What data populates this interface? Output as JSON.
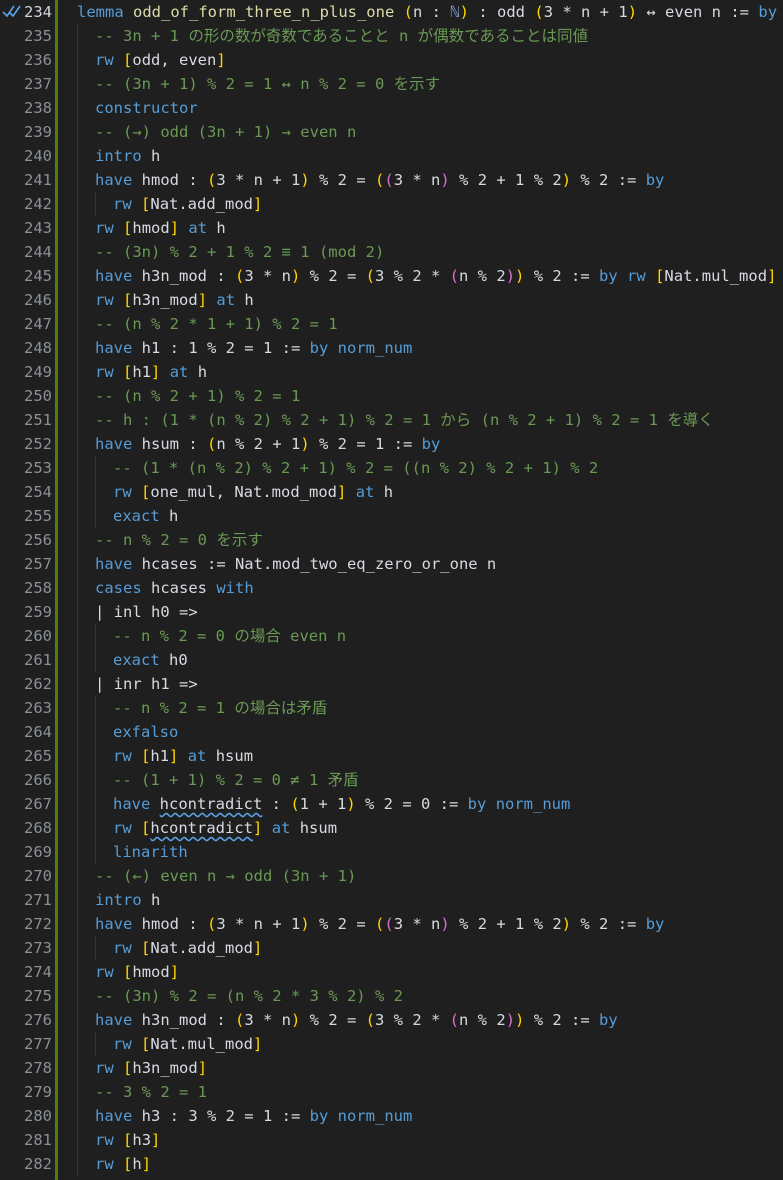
{
  "colors": {
    "keyword": "#569cd6",
    "comment": "#6a9955",
    "type": "#8aa8e0",
    "func": "#dcdcaa",
    "b1": "#ffd700",
    "b2": "#da70d6",
    "b3": "#179fff",
    "text": "#d7dae0",
    "gutter": "#8a8f98",
    "gutter_current": "#cfd3da"
  },
  "icons": {
    "line_234": "double-check-icon"
  },
  "lines": [
    {
      "n": "234",
      "indent": 0,
      "current": true,
      "tokens": [
        [
          "k",
          "lemma"
        ],
        [
          "p",
          " "
        ],
        [
          "f",
          "odd_of_form_three_n_plus_one"
        ],
        [
          "p",
          " "
        ],
        [
          "b1",
          "("
        ],
        [
          "p",
          "n : "
        ],
        [
          "t",
          "ℕ"
        ],
        [
          "b1",
          ")"
        ],
        [
          "p",
          " : odd "
        ],
        [
          "b1",
          "("
        ],
        [
          "p",
          "3 * n + 1"
        ],
        [
          "b1",
          ")"
        ],
        [
          "p",
          " ↔ even n := "
        ],
        [
          "k",
          "by"
        ]
      ]
    },
    {
      "n": "235",
      "indent": 1,
      "tokens": [
        [
          "c",
          "-- 3n + 1 の形の数が奇数であることと n が偶数であることは同値"
        ]
      ]
    },
    {
      "n": "236",
      "indent": 1,
      "tokens": [
        [
          "k",
          "rw"
        ],
        [
          "p",
          " "
        ],
        [
          "b1",
          "["
        ],
        [
          "p",
          "odd, even"
        ],
        [
          "b1",
          "]"
        ]
      ]
    },
    {
      "n": "237",
      "indent": 1,
      "tokens": [
        [
          "c",
          "-- (3n + 1) % 2 = 1 ↔ n % 2 = 0 を示す"
        ]
      ]
    },
    {
      "n": "238",
      "indent": 1,
      "tokens": [
        [
          "k",
          "constructor"
        ]
      ]
    },
    {
      "n": "239",
      "indent": 1,
      "tokens": [
        [
          "c",
          "-- (→) odd (3n + 1) → even n"
        ]
      ]
    },
    {
      "n": "240",
      "indent": 1,
      "tokens": [
        [
          "k",
          "intro"
        ],
        [
          "p",
          " h"
        ]
      ]
    },
    {
      "n": "241",
      "indent": 1,
      "tokens": [
        [
          "k",
          "have"
        ],
        [
          "p",
          " hmod : "
        ],
        [
          "b1",
          "("
        ],
        [
          "p",
          "3 * n + 1"
        ],
        [
          "b1",
          ")"
        ],
        [
          "p",
          " % 2 = "
        ],
        [
          "b1",
          "("
        ],
        [
          "b2",
          "("
        ],
        [
          "p",
          "3 * n"
        ],
        [
          "b2",
          ")"
        ],
        [
          "p",
          " % 2 + 1 % 2"
        ],
        [
          "b1",
          ")"
        ],
        [
          "p",
          " % 2 := "
        ],
        [
          "k",
          "by"
        ]
      ]
    },
    {
      "n": "242",
      "indent": 2,
      "tokens": [
        [
          "k",
          "rw"
        ],
        [
          "p",
          " "
        ],
        [
          "b1",
          "["
        ],
        [
          "p",
          "Nat.add_mod"
        ],
        [
          "b1",
          "]"
        ]
      ]
    },
    {
      "n": "243",
      "indent": 1,
      "tokens": [
        [
          "k",
          "rw"
        ],
        [
          "p",
          " "
        ],
        [
          "b1",
          "["
        ],
        [
          "p",
          "hmod"
        ],
        [
          "b1",
          "]"
        ],
        [
          "p",
          " "
        ],
        [
          "k",
          "at"
        ],
        [
          "p",
          " h"
        ]
      ]
    },
    {
      "n": "244",
      "indent": 1,
      "tokens": [
        [
          "c",
          "-- (3n) % 2 + 1 % 2 ≡ 1 (mod 2)"
        ]
      ]
    },
    {
      "n": "245",
      "indent": 1,
      "tokens": [
        [
          "k",
          "have"
        ],
        [
          "p",
          " h3n_mod : "
        ],
        [
          "b1",
          "("
        ],
        [
          "p",
          "3 * n"
        ],
        [
          "b1",
          ")"
        ],
        [
          "p",
          " % 2 = "
        ],
        [
          "b1",
          "("
        ],
        [
          "p",
          "3 % 2 * "
        ],
        [
          "b2",
          "("
        ],
        [
          "p",
          "n % 2"
        ],
        [
          "b2",
          ")"
        ],
        [
          "b1",
          ")"
        ],
        [
          "p",
          " % 2 := "
        ],
        [
          "k",
          "by"
        ],
        [
          "p",
          " "
        ],
        [
          "k",
          "rw"
        ],
        [
          "p",
          " "
        ],
        [
          "b1",
          "["
        ],
        [
          "p",
          "Nat.mul_mod"
        ],
        [
          "b1",
          "]"
        ]
      ]
    },
    {
      "n": "246",
      "indent": 1,
      "tokens": [
        [
          "k",
          "rw"
        ],
        [
          "p",
          " "
        ],
        [
          "b1",
          "["
        ],
        [
          "p",
          "h3n_mod"
        ],
        [
          "b1",
          "]"
        ],
        [
          "p",
          " "
        ],
        [
          "k",
          "at"
        ],
        [
          "p",
          " h"
        ]
      ]
    },
    {
      "n": "247",
      "indent": 1,
      "tokens": [
        [
          "c",
          "-- (n % 2 * 1 + 1) % 2 = 1"
        ]
      ]
    },
    {
      "n": "248",
      "indent": 1,
      "tokens": [
        [
          "k",
          "have"
        ],
        [
          "p",
          " h1 : 1 % 2 = 1 := "
        ],
        [
          "k",
          "by"
        ],
        [
          "p",
          " "
        ],
        [
          "k",
          "norm_num"
        ]
      ]
    },
    {
      "n": "249",
      "indent": 1,
      "tokens": [
        [
          "k",
          "rw"
        ],
        [
          "p",
          " "
        ],
        [
          "b1",
          "["
        ],
        [
          "p",
          "h1"
        ],
        [
          "b1",
          "]"
        ],
        [
          "p",
          " "
        ],
        [
          "k",
          "at"
        ],
        [
          "p",
          " h"
        ]
      ]
    },
    {
      "n": "250",
      "indent": 1,
      "tokens": [
        [
          "c",
          "-- (n % 2 + 1) % 2 = 1"
        ]
      ]
    },
    {
      "n": "251",
      "indent": 1,
      "tokens": [
        [
          "c",
          "-- h : (1 * (n % 2) % 2 + 1) % 2 = 1 から (n % 2 + 1) % 2 = 1 を導く"
        ]
      ]
    },
    {
      "n": "252",
      "indent": 1,
      "tokens": [
        [
          "k",
          "have"
        ],
        [
          "p",
          " hsum : "
        ],
        [
          "b1",
          "("
        ],
        [
          "p",
          "n % 2 + 1"
        ],
        [
          "b1",
          ")"
        ],
        [
          "p",
          " % 2 = 1 := "
        ],
        [
          "k",
          "by"
        ]
      ]
    },
    {
      "n": "253",
      "indent": 2,
      "tokens": [
        [
          "c",
          "-- (1 * (n % 2) % 2 + 1) % 2 = ((n % 2) % 2 + 1) % 2"
        ]
      ]
    },
    {
      "n": "254",
      "indent": 2,
      "tokens": [
        [
          "k",
          "rw"
        ],
        [
          "p",
          " "
        ],
        [
          "b1",
          "["
        ],
        [
          "p",
          "one_mul, Nat.mod_mod"
        ],
        [
          "b1",
          "]"
        ],
        [
          "p",
          " "
        ],
        [
          "k",
          "at"
        ],
        [
          "p",
          " h"
        ]
      ]
    },
    {
      "n": "255",
      "indent": 2,
      "tokens": [
        [
          "k",
          "exact"
        ],
        [
          "p",
          " h"
        ]
      ]
    },
    {
      "n": "256",
      "indent": 1,
      "tokens": [
        [
          "c",
          "-- n % 2 = 0 を示す"
        ]
      ]
    },
    {
      "n": "257",
      "indent": 1,
      "tokens": [
        [
          "k",
          "have"
        ],
        [
          "p",
          " hcases := Nat.mod_two_eq_zero_or_one n"
        ]
      ]
    },
    {
      "n": "258",
      "indent": 1,
      "tokens": [
        [
          "k",
          "cases"
        ],
        [
          "p",
          " hcases "
        ],
        [
          "k",
          "with"
        ]
      ]
    },
    {
      "n": "259",
      "indent": 1,
      "tokens": [
        [
          "p",
          "| inl h0 =>"
        ]
      ]
    },
    {
      "n": "260",
      "indent": 2,
      "tokens": [
        [
          "c",
          "-- n % 2 = 0 の場合 even n"
        ]
      ]
    },
    {
      "n": "261",
      "indent": 2,
      "tokens": [
        [
          "k",
          "exact"
        ],
        [
          "p",
          " h0"
        ]
      ]
    },
    {
      "n": "262",
      "indent": 1,
      "tokens": [
        [
          "p",
          "| inr h1 =>"
        ]
      ]
    },
    {
      "n": "263",
      "indent": 2,
      "tokens": [
        [
          "c",
          "-- n % 2 = 1 の場合は矛盾"
        ]
      ]
    },
    {
      "n": "264",
      "indent": 2,
      "tokens": [
        [
          "k",
          "exfalso"
        ]
      ]
    },
    {
      "n": "265",
      "indent": 2,
      "tokens": [
        [
          "k",
          "rw"
        ],
        [
          "p",
          " "
        ],
        [
          "b1",
          "["
        ],
        [
          "p",
          "h1"
        ],
        [
          "b1",
          "]"
        ],
        [
          "p",
          " "
        ],
        [
          "k",
          "at"
        ],
        [
          "p",
          " hsum"
        ]
      ]
    },
    {
      "n": "266",
      "indent": 2,
      "tokens": [
        [
          "c",
          "-- (1 + 1) % 2 = 0 ≠ 1 矛盾"
        ]
      ]
    },
    {
      "n": "267",
      "indent": 2,
      "tokens": [
        [
          "k",
          "have"
        ],
        [
          "p",
          " "
        ],
        [
          "s",
          "hcontradict"
        ],
        [
          "p",
          " : "
        ],
        [
          "b1",
          "("
        ],
        [
          "p",
          "1 + 1"
        ],
        [
          "b1",
          ")"
        ],
        [
          "p",
          " % 2 = 0 := "
        ],
        [
          "k",
          "by"
        ],
        [
          "p",
          " "
        ],
        [
          "k",
          "norm_num"
        ]
      ]
    },
    {
      "n": "268",
      "indent": 2,
      "tokens": [
        [
          "k",
          "rw"
        ],
        [
          "p",
          " "
        ],
        [
          "b1",
          "["
        ],
        [
          "s",
          "hcontradict"
        ],
        [
          "b1",
          "]"
        ],
        [
          "p",
          " "
        ],
        [
          "k",
          "at"
        ],
        [
          "p",
          " hsum"
        ]
      ]
    },
    {
      "n": "269",
      "indent": 2,
      "tokens": [
        [
          "k",
          "linarith"
        ]
      ]
    },
    {
      "n": "270",
      "indent": 1,
      "tokens": [
        [
          "c",
          "-- (←) even n → odd (3n + 1)"
        ]
      ]
    },
    {
      "n": "271",
      "indent": 1,
      "tokens": [
        [
          "k",
          "intro"
        ],
        [
          "p",
          " h"
        ]
      ]
    },
    {
      "n": "272",
      "indent": 1,
      "tokens": [
        [
          "k",
          "have"
        ],
        [
          "p",
          " hmod : "
        ],
        [
          "b1",
          "("
        ],
        [
          "p",
          "3 * n + 1"
        ],
        [
          "b1",
          ")"
        ],
        [
          "p",
          " % 2 = "
        ],
        [
          "b1",
          "("
        ],
        [
          "b2",
          "("
        ],
        [
          "p",
          "3 * n"
        ],
        [
          "b2",
          ")"
        ],
        [
          "p",
          " % 2 + 1 % 2"
        ],
        [
          "b1",
          ")"
        ],
        [
          "p",
          " % 2 := "
        ],
        [
          "k",
          "by"
        ]
      ]
    },
    {
      "n": "273",
      "indent": 2,
      "tokens": [
        [
          "k",
          "rw"
        ],
        [
          "p",
          " "
        ],
        [
          "b1",
          "["
        ],
        [
          "p",
          "Nat.add_mod"
        ],
        [
          "b1",
          "]"
        ]
      ]
    },
    {
      "n": "274",
      "indent": 1,
      "tokens": [
        [
          "k",
          "rw"
        ],
        [
          "p",
          " "
        ],
        [
          "b1",
          "["
        ],
        [
          "p",
          "hmod"
        ],
        [
          "b1",
          "]"
        ]
      ]
    },
    {
      "n": "275",
      "indent": 1,
      "tokens": [
        [
          "c",
          "-- (3n) % 2 = (n % 2 * 3 % 2) % 2"
        ]
      ]
    },
    {
      "n": "276",
      "indent": 1,
      "tokens": [
        [
          "k",
          "have"
        ],
        [
          "p",
          " h3n_mod : "
        ],
        [
          "b1",
          "("
        ],
        [
          "p",
          "3 * n"
        ],
        [
          "b1",
          ")"
        ],
        [
          "p",
          " % 2 = "
        ],
        [
          "b1",
          "("
        ],
        [
          "p",
          "3 % 2 * "
        ],
        [
          "b2",
          "("
        ],
        [
          "p",
          "n % 2"
        ],
        [
          "b2",
          ")"
        ],
        [
          "b1",
          ")"
        ],
        [
          "p",
          " % 2 := "
        ],
        [
          "k",
          "by"
        ]
      ]
    },
    {
      "n": "277",
      "indent": 2,
      "tokens": [
        [
          "k",
          "rw"
        ],
        [
          "p",
          " "
        ],
        [
          "b1",
          "["
        ],
        [
          "p",
          "Nat.mul_mod"
        ],
        [
          "b1",
          "]"
        ]
      ]
    },
    {
      "n": "278",
      "indent": 1,
      "tokens": [
        [
          "k",
          "rw"
        ],
        [
          "p",
          " "
        ],
        [
          "b1",
          "["
        ],
        [
          "p",
          "h3n_mod"
        ],
        [
          "b1",
          "]"
        ]
      ]
    },
    {
      "n": "279",
      "indent": 1,
      "tokens": [
        [
          "c",
          "-- 3 % 2 = 1"
        ]
      ]
    },
    {
      "n": "280",
      "indent": 1,
      "tokens": [
        [
          "k",
          "have"
        ],
        [
          "p",
          " h3 : 3 % 2 = 1 := "
        ],
        [
          "k",
          "by"
        ],
        [
          "p",
          " "
        ],
        [
          "k",
          "norm_num"
        ]
      ]
    },
    {
      "n": "281",
      "indent": 1,
      "tokens": [
        [
          "k",
          "rw"
        ],
        [
          "p",
          " "
        ],
        [
          "b1",
          "["
        ],
        [
          "p",
          "h3"
        ],
        [
          "b1",
          "]"
        ]
      ]
    },
    {
      "n": "282",
      "indent": 1,
      "tokens": [
        [
          "k",
          "rw"
        ],
        [
          "p",
          " "
        ],
        [
          "b1",
          "["
        ],
        [
          "p",
          "h"
        ],
        [
          "b1",
          "]"
        ]
      ]
    }
  ]
}
